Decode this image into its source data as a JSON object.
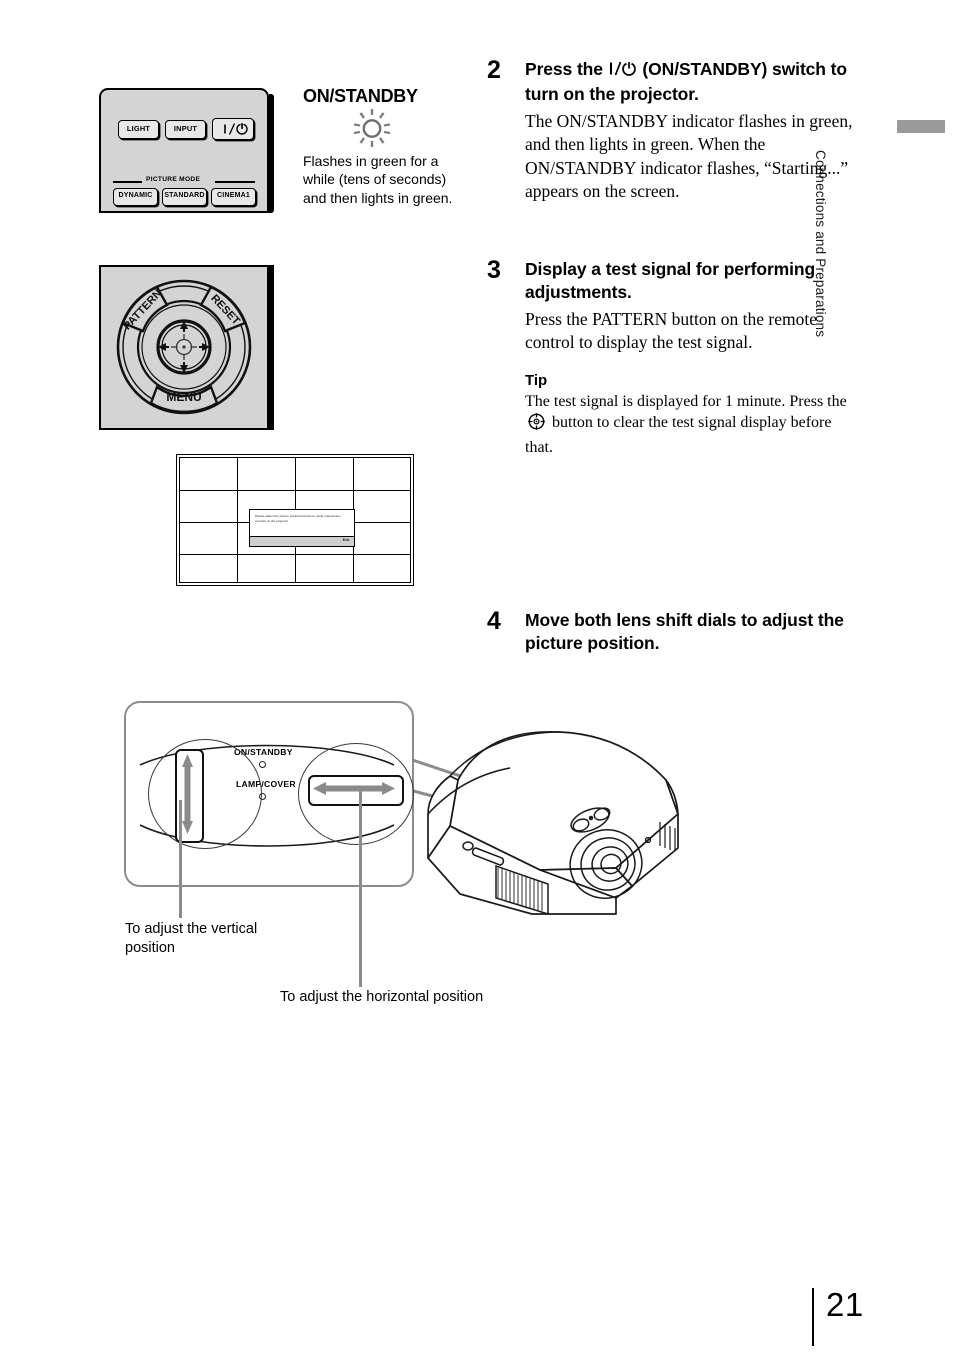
{
  "page": {
    "number": "21",
    "side_tab": "Connections and Preparations"
  },
  "remote_power": {
    "buttons": [
      {
        "label": "LIGHT"
      },
      {
        "label": "INPUT"
      },
      {
        "label": "I/⏻"
      }
    ],
    "picture_mode_label": "PICTURE MODE",
    "picture_mode_buttons": [
      {
        "label": "DYNAMIC"
      },
      {
        "label": "STANDARD"
      },
      {
        "label": "CINEMA1"
      }
    ]
  },
  "indicator_callout": {
    "title": "ON/STANDBY",
    "note": "Flashes in green for a while (tens of seconds) and then lights in green."
  },
  "remote_dpad": {
    "pattern_label": "PATTERN",
    "reset_label": "RESET",
    "menu_label": "MENU"
  },
  "test_pattern": {
    "columns": 4,
    "rows": 4,
    "dialog_message": "Please adjust the picture position/size/focus using manual lens controls on the projector.",
    "dialog_exit_label": "Exit"
  },
  "steps": [
    {
      "number": "2",
      "heading_pre": "Press the ",
      "heading_post": " (ON/STANDBY) switch to turn on the projector.",
      "body": "The ON/STANDBY indicator flashes in green, and then lights in green. When the ON/STANDBY indicator flashes, “Starting...” appears on the screen."
    },
    {
      "number": "3",
      "heading": "Display a test signal for performing adjustments.",
      "body": "Press the PATTERN button on the remote control to display the test signal.",
      "tip_heading": "Tip",
      "tip_body_pre": "The test signal is displayed for 1 minute. Press the ",
      "tip_body_post": " button to clear the test signal display before that."
    },
    {
      "number": "4",
      "heading": "Move both lens shift dials to adjust the picture position."
    }
  ],
  "lens_shift": {
    "indicator_on_standby": "ON/STANDBY",
    "indicator_lamp_cover": "LAMP/COVER",
    "caption_vertical": "To adjust the vertical position",
    "caption_horizontal": "To adjust the horizontal position"
  },
  "colors": {
    "remote_body": "#d4d4d4",
    "callout_border": "#8c8c8c",
    "side_tab_bar": "#9a9a9a",
    "dialog_bar": "#cfcfcf"
  }
}
